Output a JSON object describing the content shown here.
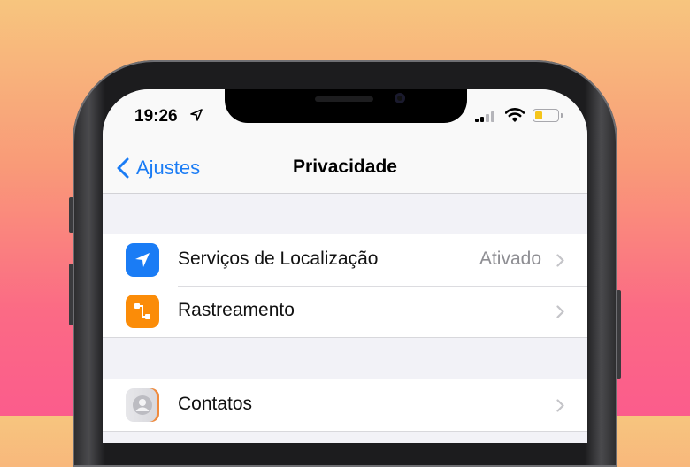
{
  "status_bar": {
    "time": "19:26",
    "location_icon": "location-arrow-icon",
    "signal_icon": "cellular-signal-icon",
    "wifi_icon": "wifi-icon",
    "battery_icon": "battery-low-icon",
    "battery_fill_color": "#f5c51a"
  },
  "nav": {
    "back_label": "Ajustes",
    "title": "Privacidade",
    "accent_color": "#1a7cf5"
  },
  "settings": {
    "group1": [
      {
        "label": "Serviços de Localização",
        "value": "Ativado",
        "icon": "location-arrow-icon",
        "icon_color": "#1a7cf5"
      },
      {
        "label": "Rastreamento",
        "value": "",
        "icon": "tracking-icon",
        "icon_color": "#fb8c08"
      }
    ],
    "group2": [
      {
        "label": "Contatos",
        "value": "",
        "icon": "contacts-icon",
        "icon_color": "#d7d7dc"
      }
    ]
  }
}
